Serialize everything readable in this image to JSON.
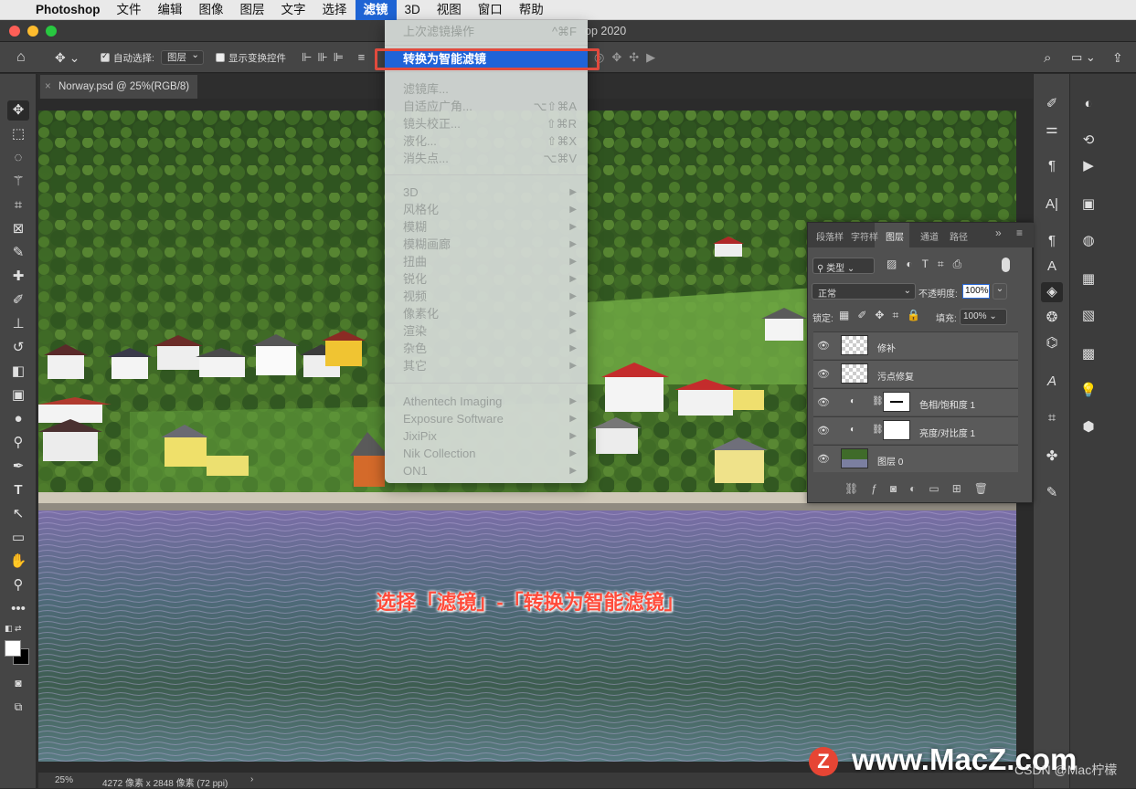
{
  "menubar": {
    "apple": "",
    "items": [
      "Photoshop",
      "文件",
      "编辑",
      "图像",
      "图层",
      "文字",
      "选择",
      "滤镜",
      "3D",
      "视图",
      "窗口",
      "帮助"
    ]
  },
  "window": {
    "title": "op 2020"
  },
  "options_bar": {
    "auto_select_label": "自动选择:",
    "auto_select_value": "图层",
    "show_transform_label": "显示变换控件"
  },
  "document_tab": {
    "label": "Norway.psd @ 25%(RGB/8)"
  },
  "filter_menu": {
    "last_filter": {
      "label": "上次滤镜操作",
      "shortcut": "^⌘F"
    },
    "convert_smart": "转换为智能滤镜",
    "group1": [
      {
        "label": "滤镜库...",
        "shortcut": ""
      },
      {
        "label": "自适应广角...",
        "shortcut": "⌥⇧⌘A"
      },
      {
        "label": "镜头校正...",
        "shortcut": "⇧⌘R"
      },
      {
        "label": "液化...",
        "shortcut": "⇧⌘X"
      },
      {
        "label": "消失点...",
        "shortcut": "⌥⌘V"
      }
    ],
    "group2": [
      "3D",
      "风格化",
      "模糊",
      "模糊画廊",
      "扭曲",
      "锐化",
      "视频",
      "像素化",
      "渲染",
      "杂色",
      "其它"
    ],
    "group3": [
      "Athentech Imaging",
      "Exposure Software",
      "JixiPix",
      "Nik Collection",
      "ON1"
    ]
  },
  "layers_panel": {
    "tabs": [
      "段落样",
      "字符样",
      "图层",
      "通道",
      "路径"
    ],
    "filter_kind": "类型",
    "blend_mode": "正常",
    "opacity_label": "不透明度:",
    "opacity_value": "100%",
    "lock_label": "锁定:",
    "fill_label": "填充:",
    "fill_value": "100%",
    "layers": [
      "修补",
      "污点修复",
      "色相/饱和度 1",
      "亮度/对比度 1",
      "图层 0"
    ]
  },
  "status": {
    "zoom": "25%",
    "size": "4272 像素 x 2848 像素 (72 ppi)"
  },
  "overlay_caption": "选择「滤镜」-「转换为智能滤镜」",
  "watermark": "www.MacZ.com",
  "watermark_logo": "Z",
  "csdn": "CSDN @Mac柠檬"
}
